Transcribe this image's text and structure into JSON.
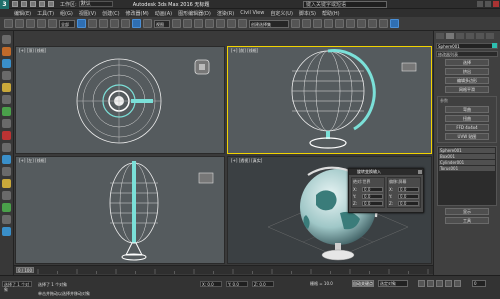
{
  "titlebar": {
    "app_title": "Autodesk 3ds Max 2016 无标题",
    "workspace_label": "工作区:",
    "workspace_value": "默认",
    "search_placeholder": "键入关键字或短语"
  },
  "menubar": {
    "items": [
      "编辑(E)",
      "工具(T)",
      "组(G)",
      "视图(V)",
      "创建(C)",
      "修改器(M)",
      "动画(A)",
      "图形编辑器(D)",
      "渲染(R)",
      "Civil View",
      "自定义(U)",
      "脚本(S)",
      "帮助(H)"
    ]
  },
  "toolbar": {
    "filter_value": "全部",
    "view_value": "视图",
    "selection_set_placeholder": "创建选择集"
  },
  "viewports": {
    "top_left_label": "[+] [顶] [线框]",
    "top_right_label": "[+] [前] [线框]",
    "bottom_left_label": "[+] [左] [线框]",
    "bottom_right_label": "[+] [透视] [真实]"
  },
  "command_panel": {
    "object_name": "Sphere001",
    "modifier_list_label": "修改器列表",
    "buttons": [
      "选择",
      "挤出",
      "编辑多边形",
      "网格平滑",
      "弯曲",
      "扭曲",
      "FFD 4x4x4",
      "UVW 贴图"
    ],
    "group_title": "参数",
    "list_items": [
      "Sphere001",
      "Box001",
      "Cylinder001",
      "Torus001"
    ],
    "bottom_buttons": [
      "显示",
      "工具"
    ]
  },
  "dialog": {
    "title": "旋转变换输入",
    "left_col_title": "绝对:世界",
    "right_col_title": "偏移:屏幕",
    "rows_left": [
      {
        "label": "X:",
        "value": "0.0"
      },
      {
        "label": "Y:",
        "value": "0.0"
      },
      {
        "label": "Z:",
        "value": "0.0"
      }
    ],
    "rows_right": [
      {
        "label": "X:",
        "value": "0.0"
      },
      {
        "label": "Y:",
        "value": "0.0"
      },
      {
        "label": "Z:",
        "value": "0.0"
      }
    ]
  },
  "timeline": {
    "frame_display": "0 / 100"
  },
  "status": {
    "selection_info": "选择了 1 个对象",
    "message1": "选择了 1 个对象",
    "message2": "单击并拖动以选择并移动对象",
    "x_value": "X: 0.0",
    "y_value": "Y: 0.0",
    "z_value": "Z: 0.0",
    "grid_label": "栅格 = 10.0",
    "autokey_label": "自动关键点",
    "setkey_value": "选定对象",
    "frame_value": "0"
  }
}
